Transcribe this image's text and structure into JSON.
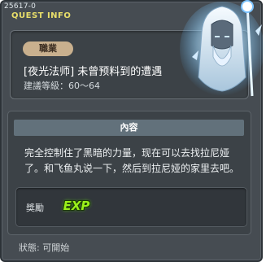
{
  "quest_id": "25617-0",
  "header": {
    "title": "QUEST INFO"
  },
  "job": {
    "label": "職業"
  },
  "quest": {
    "title": "[夜光法师] 未曾预料到的遭遇",
    "level": "建議等級：60～64"
  },
  "content": {
    "header": "內容",
    "text": "完全控制住了黑暗的力量，现在可以去找拉尼娅了。和飞鱼丸说一下，然后到拉尼娅的家里去吧。"
  },
  "reward": {
    "label": "獎勵",
    "icon": "exp-icon",
    "icon_text": "EXP"
  },
  "status": {
    "text": "狀態:  可開始"
  },
  "npc": {
    "icon": "luminous-npc-portrait"
  },
  "colors": {
    "title_yellow": "#e8de6a",
    "badge_tan": "#c9b08e",
    "exp_green": "#9af01a",
    "window_bg": "#464c52"
  }
}
